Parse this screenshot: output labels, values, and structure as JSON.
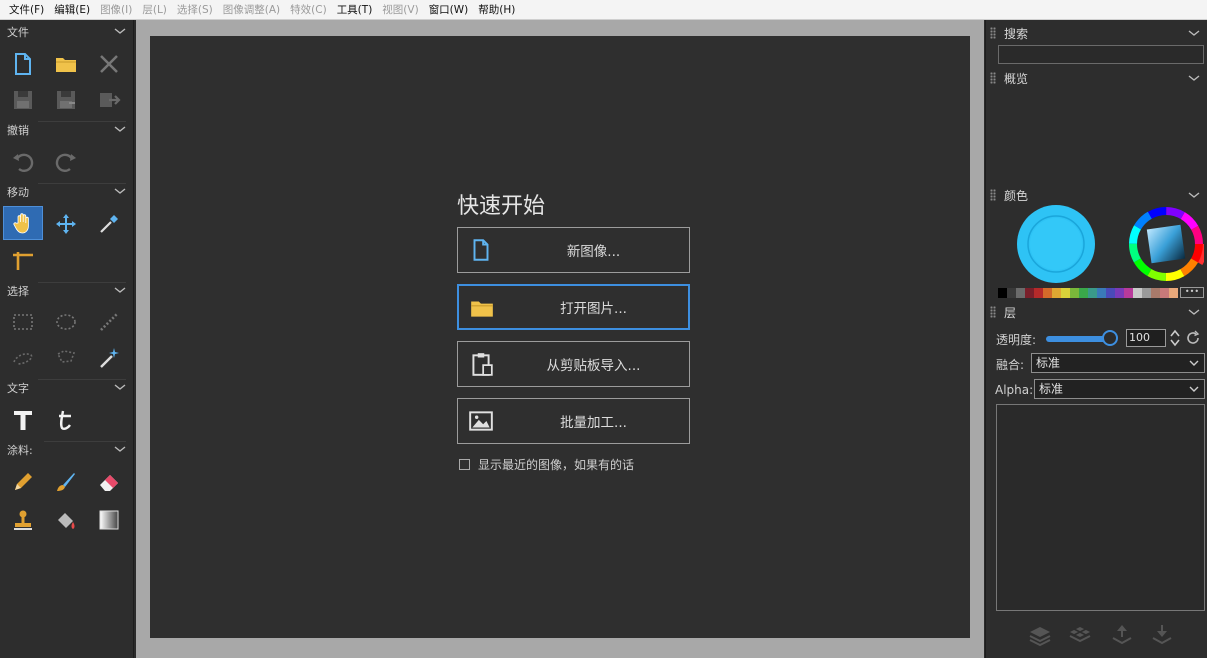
{
  "menubar": {
    "items": [
      {
        "label": "文件(F)",
        "enabled": true
      },
      {
        "label": "编辑(E)",
        "enabled": true
      },
      {
        "label": "图像(I)",
        "enabled": false
      },
      {
        "label": "层(L)",
        "enabled": false
      },
      {
        "label": "选择(S)",
        "enabled": false
      },
      {
        "label": "图像调整(A)",
        "enabled": false
      },
      {
        "label": "特效(C)",
        "enabled": false
      },
      {
        "label": "工具(T)",
        "enabled": true
      },
      {
        "label": "视图(V)",
        "enabled": false
      },
      {
        "label": "窗口(W)",
        "enabled": true
      },
      {
        "label": "帮助(H)",
        "enabled": true
      }
    ]
  },
  "toolbox": {
    "file": {
      "label": "文件"
    },
    "undo": {
      "label": "撤销"
    },
    "move": {
      "label": "移动"
    },
    "select": {
      "label": "选择"
    },
    "text": {
      "label": "文字"
    },
    "paint": {
      "label": "涂料:"
    }
  },
  "quickstart": {
    "title": "快速开始",
    "buttons": [
      {
        "label": "新图像...",
        "icon": "new-image-icon"
      },
      {
        "label": "打开图片...",
        "icon": "folder-icon"
      },
      {
        "label": "从剪贴板导入...",
        "icon": "clipboard-icon"
      },
      {
        "label": "批量加工...",
        "icon": "batch-image-icon"
      }
    ],
    "checkbox_label": "显示最近的图像，如果有的话",
    "checkbox_checked": false
  },
  "right_panel": {
    "search": {
      "title": "搜索",
      "value": ""
    },
    "overview": {
      "title": "概览"
    },
    "color": {
      "title": "颜色",
      "primary": "#2ec3f5",
      "palette": [
        "#000000",
        "#3a3a3a",
        "#6b6b6b",
        "#7a1f2a",
        "#b52a2a",
        "#d46a2a",
        "#e0a832",
        "#d8d23a",
        "#7ab83a",
        "#3aa84a",
        "#3a9a8a",
        "#3a7ab8",
        "#4a4ab8",
        "#7a3ab8",
        "#b83a9a",
        "#c8c8c8",
        "#9a9a9a",
        "#a87a6a",
        "#c87a7a",
        "#e8a87a",
        "#e8d87a",
        "#b8d87a",
        "#7ad8a8",
        "#7ac8d8",
        "#7a9ae8",
        "#9a7ae8",
        "#c87ad8",
        "#3a7ad8"
      ],
      "more_label": "•••"
    },
    "layers": {
      "title": "层",
      "opacity_label": "透明度:",
      "opacity_value": "100",
      "blend_label": "融合:",
      "blend_value": "标准",
      "alpha_label": "Alpha:",
      "alpha_value": "标准"
    }
  }
}
